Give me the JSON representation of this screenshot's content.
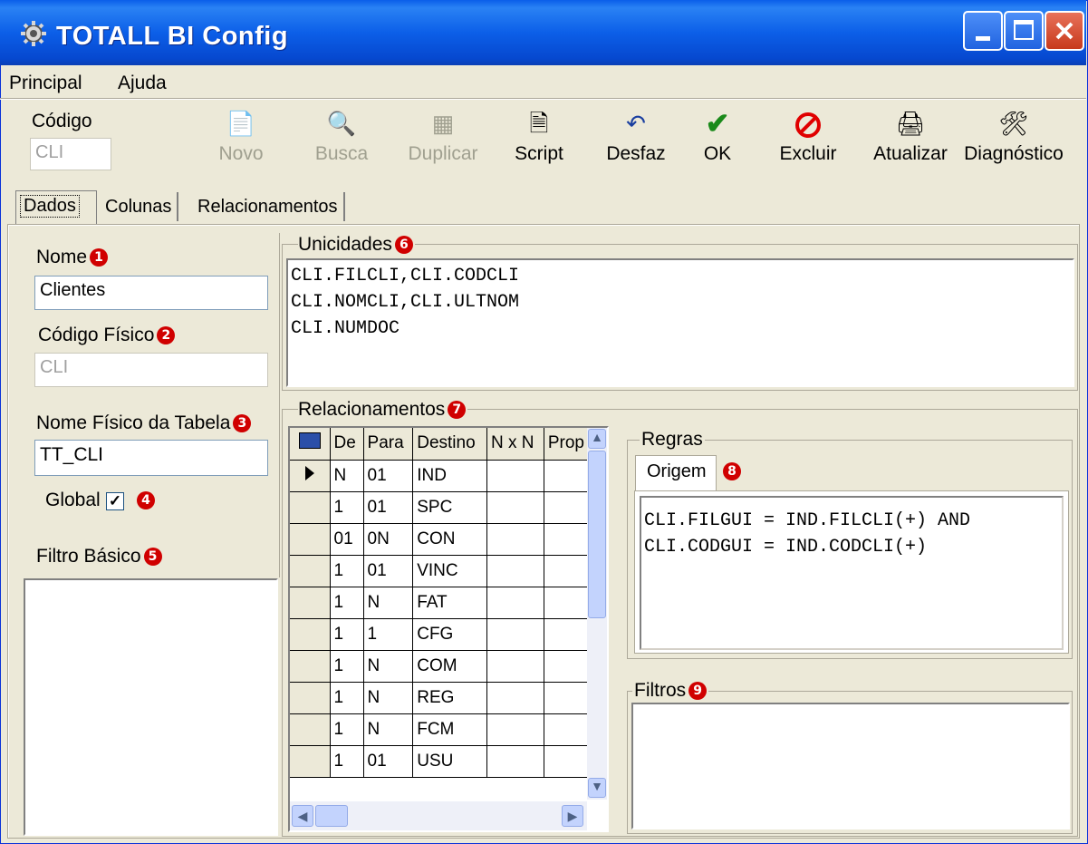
{
  "window": {
    "title": "TOTALL BI Config"
  },
  "menu": {
    "principal": "Principal",
    "ajuda": "Ajuda"
  },
  "code": {
    "label": "Código",
    "value": "CLI"
  },
  "toolbar": {
    "novo": "Novo",
    "busca": "Busca",
    "duplicar": "Duplicar",
    "script": "Script",
    "desfaz": "Desfaz",
    "ok": "OK",
    "excluir": "Excluir",
    "atualizar": "Atualizar",
    "diagnostico": "Diagnóstico"
  },
  "tabs": {
    "dados": "Dados",
    "colunas": "Colunas",
    "relacionamentos": "Relacionamentos"
  },
  "form": {
    "nome_label": "Nome",
    "nome_value": "Clientes",
    "codigo_fisico_label": "Código Físico",
    "codigo_fisico_value": "CLI",
    "nome_fisico_label": "Nome Físico da Tabela",
    "nome_fisico_value": "TT_CLI",
    "global_label": "Global",
    "global_checked": true,
    "filtro_basico_label": "Filtro Básico"
  },
  "badges": {
    "b1": "1",
    "b2": "2",
    "b3": "3",
    "b4": "4",
    "b5": "5",
    "b6": "6",
    "b7": "7",
    "b8": "8",
    "b9": "9"
  },
  "unicidades": {
    "label": "Unicidades",
    "lines": [
      "CLI.FILCLI,CLI.CODCLI",
      "CLI.NOMCLI,CLI.ULTNOM",
      "CLI.NUMDOC"
    ]
  },
  "relacionamentos": {
    "label": "Relacionamentos",
    "columns": [
      "De",
      "Para",
      "Destino",
      "N x N",
      "Prop"
    ],
    "rows": [
      [
        "N",
        "01",
        "IND"
      ],
      [
        "1",
        "01",
        "SPC"
      ],
      [
        "01",
        "0N",
        "CON"
      ],
      [
        "1",
        "01",
        "VINC"
      ],
      [
        "1",
        "N",
        "FAT"
      ],
      [
        "1",
        "1",
        "CFG"
      ],
      [
        "1",
        "N",
        "COM"
      ],
      [
        "1",
        "N",
        "REG"
      ],
      [
        "1",
        "N",
        "FCM"
      ],
      [
        "1",
        "01",
        "USU"
      ]
    ]
  },
  "regras": {
    "label": "Regras",
    "tab": "Origem",
    "lines": [
      "CLI.FILGUI = IND.FILCLI(+) AND",
      "CLI.CODGUI = IND.CODCLI(+)"
    ]
  },
  "filtros": {
    "label": "Filtros"
  },
  "colors": {
    "title_bar": "#0c5fe8",
    "window_bg": "#ece9d8",
    "badge": "#d00000",
    "ok_check": "#1a8a1a",
    "excluir": "#e00000"
  }
}
